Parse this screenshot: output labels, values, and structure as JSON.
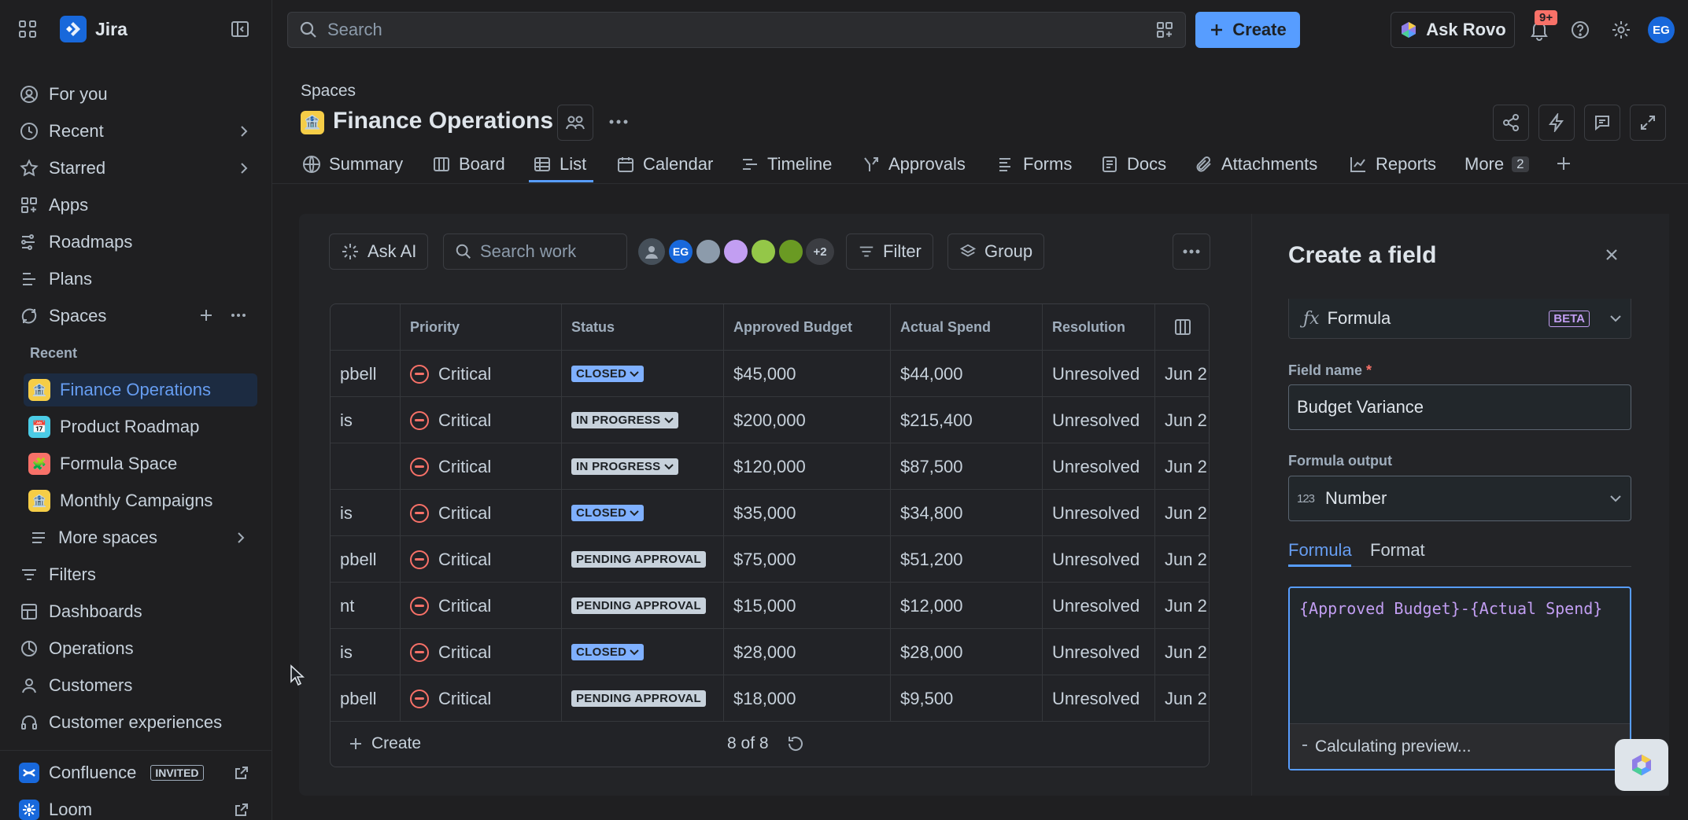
{
  "app": {
    "name": "Jira"
  },
  "sidebar": {
    "items": [
      {
        "label": "For you"
      },
      {
        "label": "Recent"
      },
      {
        "label": "Starred"
      },
      {
        "label": "Apps"
      },
      {
        "label": "Roadmaps"
      },
      {
        "label": "Plans"
      },
      {
        "label": "Spaces"
      }
    ],
    "recent_label": "Recent",
    "spaces": [
      {
        "label": "Finance Operations"
      },
      {
        "label": "Product Roadmap"
      },
      {
        "label": "Formula Space"
      },
      {
        "label": "Monthly Campaigns"
      }
    ],
    "more_spaces": "More spaces",
    "bottom_items": [
      {
        "label": "Filters"
      },
      {
        "label": "Dashboards"
      },
      {
        "label": "Operations"
      },
      {
        "label": "Customers"
      },
      {
        "label": "Customer experiences"
      }
    ],
    "confluence": {
      "label": "Confluence",
      "badge": "INVITED"
    },
    "loom": {
      "label": "Loom"
    }
  },
  "topbar": {
    "search_placeholder": "Search",
    "create_label": "Create",
    "ask_rovo_label": "Ask Rovo",
    "notifications_badge": "9+",
    "user_initials": "EG"
  },
  "header": {
    "breadcrumb": "Spaces",
    "title": "Finance Operations",
    "tabs": [
      {
        "label": "Summary"
      },
      {
        "label": "Board"
      },
      {
        "label": "List"
      },
      {
        "label": "Calendar"
      },
      {
        "label": "Timeline"
      },
      {
        "label": "Approvals"
      },
      {
        "label": "Forms"
      },
      {
        "label": "Docs"
      },
      {
        "label": "Attachments"
      },
      {
        "label": "Reports"
      },
      {
        "label": "More"
      }
    ],
    "more_count": "2"
  },
  "toolbar": {
    "ask_ai_label": "Ask AI",
    "search_placeholder": "Search work",
    "avatar_initials": "EG",
    "avatar_more": "+2",
    "filter_label": "Filter",
    "group_label": "Group"
  },
  "table": {
    "columns": [
      "Priority",
      "Status",
      "Approved Budget",
      "Actual Spend",
      "Resolution"
    ],
    "rows": [
      {
        "assignee": "pbell",
        "priority": "Critical",
        "status": "CLOSED",
        "budget": "$45,000",
        "spend": "$44,000",
        "resolution": "Unresolved",
        "date": "Jun 2"
      },
      {
        "assignee": "is",
        "priority": "Critical",
        "status": "IN PROGRESS",
        "budget": "$200,000",
        "spend": "$215,400",
        "resolution": "Unresolved",
        "date": "Jun 2"
      },
      {
        "assignee": "",
        "priority": "Critical",
        "status": "IN PROGRESS",
        "budget": "$120,000",
        "spend": "$87,500",
        "resolution": "Unresolved",
        "date": "Jun 2"
      },
      {
        "assignee": "is",
        "priority": "Critical",
        "status": "CLOSED",
        "budget": "$35,000",
        "spend": "$34,800",
        "resolution": "Unresolved",
        "date": "Jun 2"
      },
      {
        "assignee": "pbell",
        "priority": "Critical",
        "status": "PENDING APPROVAL",
        "budget": "$75,000",
        "spend": "$51,200",
        "resolution": "Unresolved",
        "date": "Jun 2"
      },
      {
        "assignee": "nt",
        "priority": "Critical",
        "status": "PENDING APPROVAL",
        "budget": "$15,000",
        "spend": "$12,000",
        "resolution": "Unresolved",
        "date": "Jun 2"
      },
      {
        "assignee": "is",
        "priority": "Critical",
        "status": "CLOSED",
        "budget": "$28,000",
        "spend": "$28,000",
        "resolution": "Unresolved",
        "date": "Jun 2"
      },
      {
        "assignee": "pbell",
        "priority": "Critical",
        "status": "PENDING APPROVAL",
        "budget": "$18,000",
        "spend": "$9,500",
        "resolution": "Unresolved",
        "date": "Jun 2"
      }
    ],
    "footer_create": "Create",
    "footer_count": "8 of 8"
  },
  "panel": {
    "title": "Create a field",
    "field_type": "Formula",
    "field_type_badge": "BETA",
    "field_name_label": "Field name",
    "required_mark": "*",
    "field_name_value": "Budget Variance",
    "formula_output_label": "Formula output",
    "formula_output_value": "Number",
    "tabs": [
      {
        "label": "Formula"
      },
      {
        "label": "Format"
      }
    ],
    "formula_text": "{Approved Budget}-{Actual Spend}",
    "preview_text": "Calculating preview..."
  },
  "colors": {
    "accent": "#579dff",
    "critical": "#f87168",
    "formula_text": "#c29ef2"
  }
}
